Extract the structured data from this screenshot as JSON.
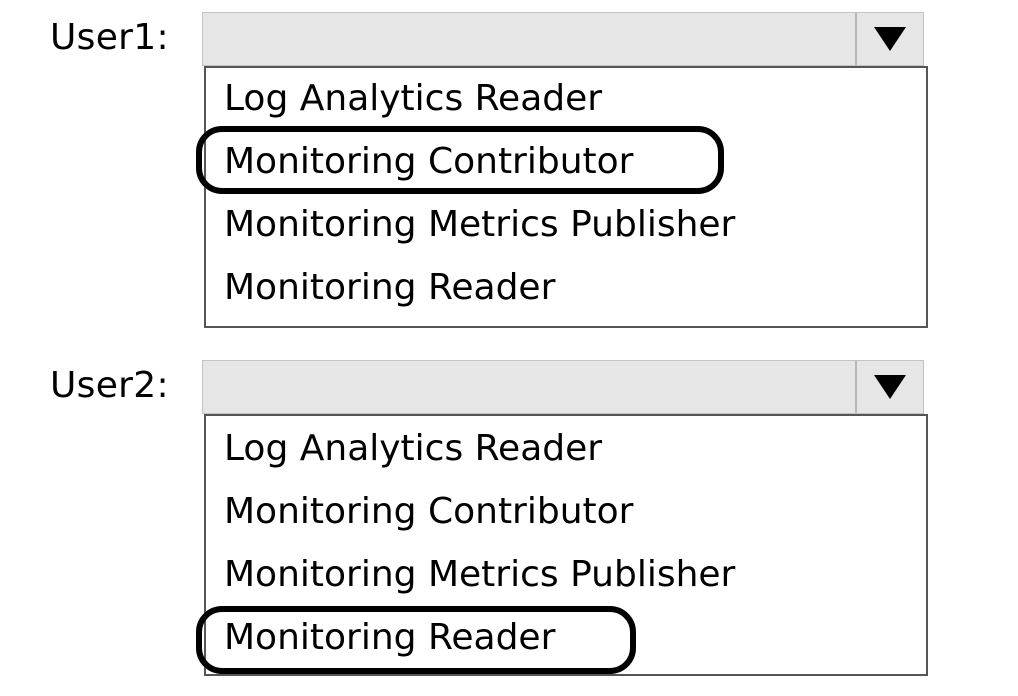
{
  "user1": {
    "label": "User1:",
    "options": [
      "Log Analytics Reader",
      "Monitoring Contributor",
      "Monitoring Metrics Publisher",
      "Monitoring Reader"
    ],
    "circled_option": "Monitoring Contributor",
    "dropdown_icon": "triangle-down-icon"
  },
  "user2": {
    "label": "User2:",
    "options": [
      "Log Analytics Reader",
      "Monitoring Contributor",
      "Monitoring Metrics Publisher",
      "Monitoring Reader"
    ],
    "circled_option": "Monitoring Reader",
    "dropdown_icon": "triangle-down-icon"
  },
  "colors": {
    "dropdown_bg": "#e6e6e6",
    "list_border": "#555555",
    "circle_ink": "#000000"
  }
}
